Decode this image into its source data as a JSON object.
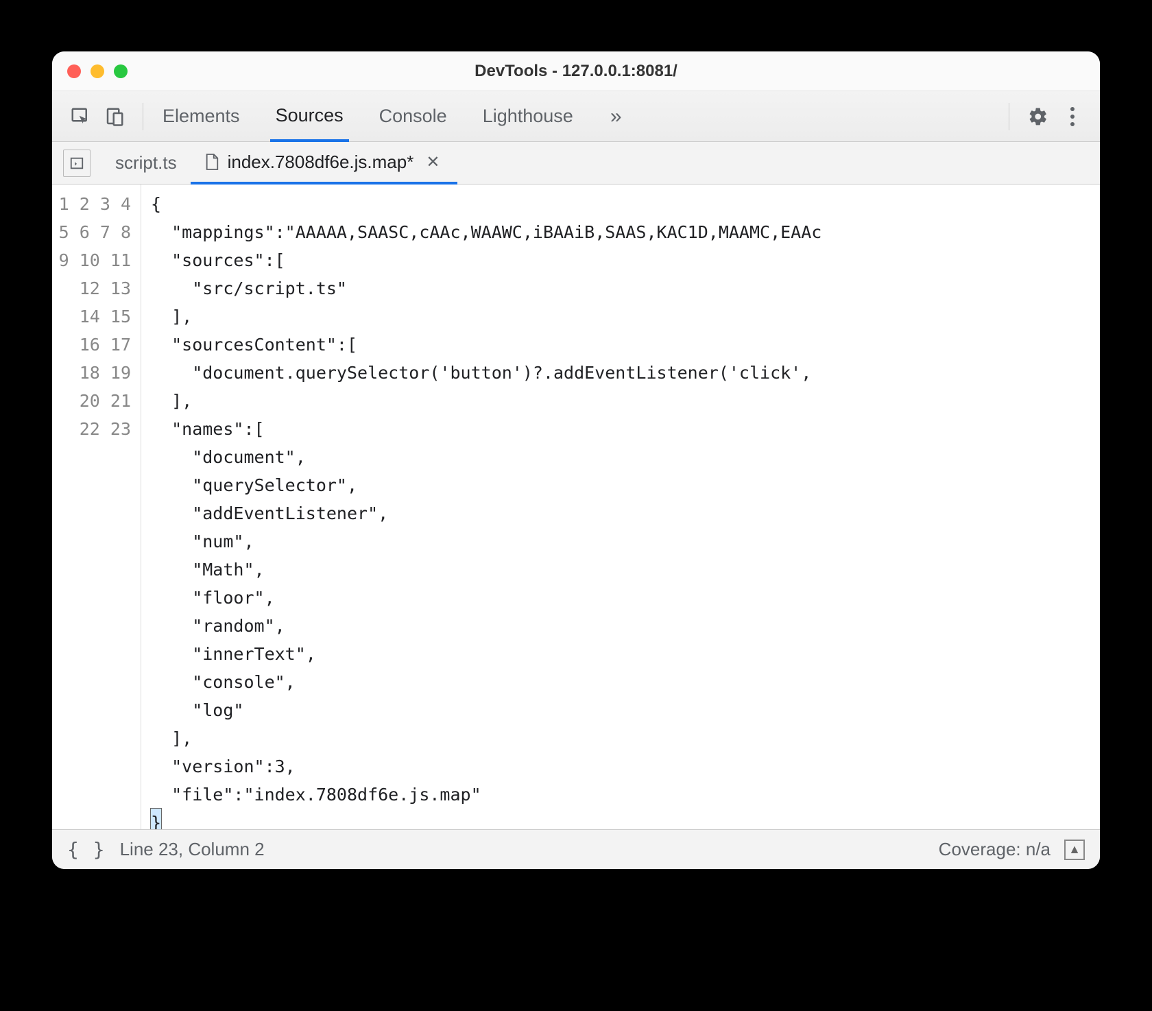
{
  "window": {
    "title": "DevTools - 127.0.0.1:8081/"
  },
  "toolbar": {
    "tabs": [
      "Elements",
      "Sources",
      "Console",
      "Lighthouse"
    ],
    "active_tab": "Sources",
    "overflow": "»"
  },
  "filetabs": {
    "items": [
      {
        "label": "script.ts",
        "modified": false,
        "has_icon": false
      },
      {
        "label": "index.7808df6e.js.map*",
        "modified": true,
        "has_icon": true
      }
    ],
    "active_index": 1
  },
  "code": {
    "lines": [
      "{",
      "  \"mappings\":\"AAAAA,SAASC,cAAc,WAAWC,iBAAiB,SAAS,KAC1D,MAAMC,EAAc",
      "  \"sources\":[",
      "    \"src/script.ts\"",
      "  ],",
      "  \"sourcesContent\":[",
      "    \"document.querySelector('button')?.addEventListener('click',",
      "  ],",
      "  \"names\":[",
      "    \"document\",",
      "    \"querySelector\",",
      "    \"addEventListener\",",
      "    \"num\",",
      "    \"Math\",",
      "    \"floor\",",
      "    \"random\",",
      "    \"innerText\",",
      "    \"console\",",
      "    \"log\"",
      "  ],",
      "  \"version\":3,",
      "  \"file\":\"index.7808df6e.js.map\"",
      "}"
    ]
  },
  "status": {
    "position": "Line 23, Column 2",
    "coverage": "Coverage: n/a"
  }
}
